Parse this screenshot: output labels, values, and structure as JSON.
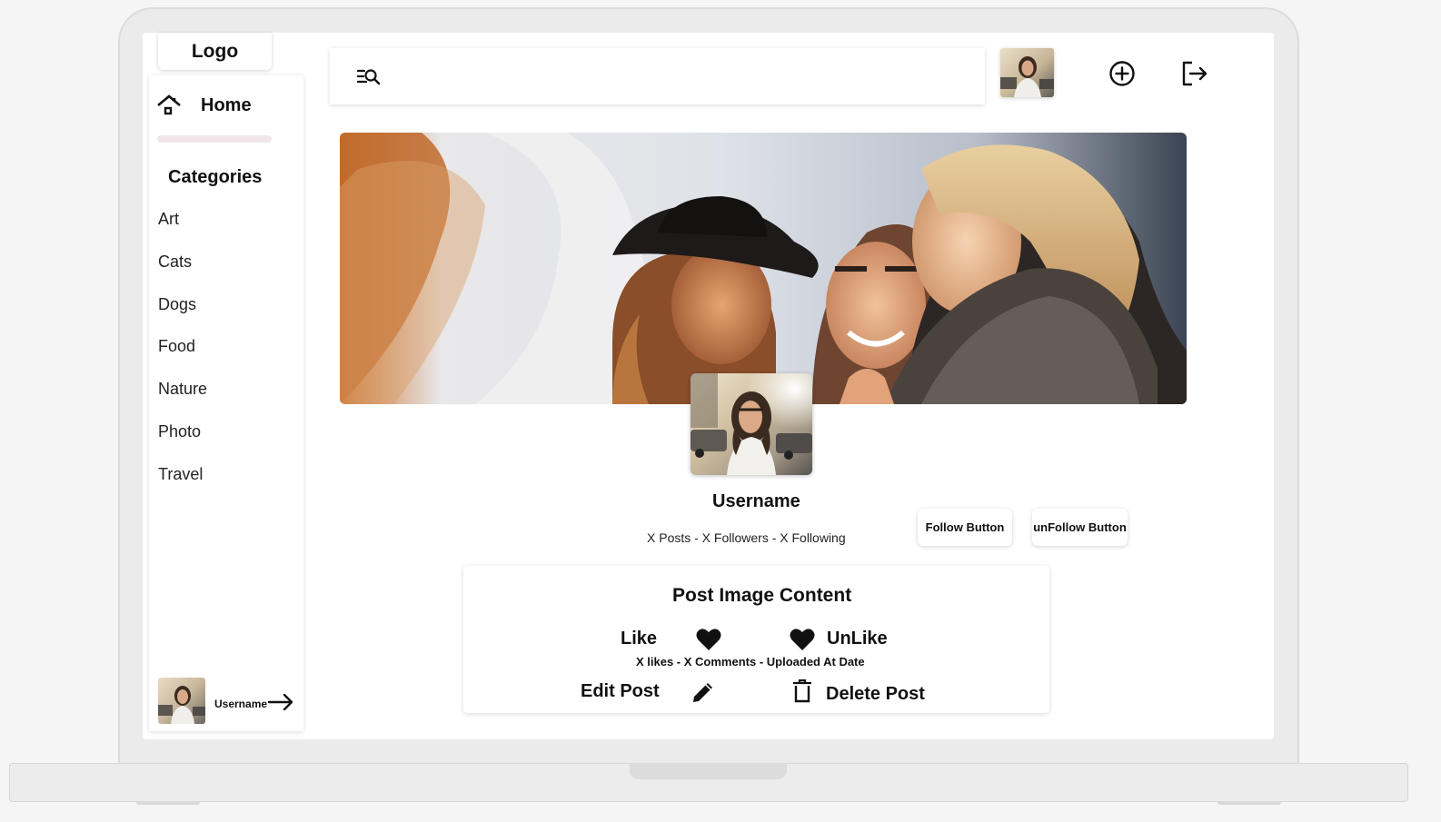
{
  "sidebar": {
    "logo": "Logo",
    "home_label": "Home",
    "categories_title": "Categories",
    "categories": [
      "Art",
      "Cats",
      "Dogs",
      "Food",
      "Nature",
      "Photo",
      "Travel"
    ],
    "user_name": "Username"
  },
  "search": {
    "placeholder": ""
  },
  "profile": {
    "username": "Username",
    "stats": "X Posts - X Followers - X Following",
    "follow_label": "Follow Button",
    "unfollow_label": "unFollow Button"
  },
  "post": {
    "title": "Post Image Content",
    "like_label": "Like",
    "unlike_label": "UnLike",
    "meta": "X likes - X Comments - Uploaded At Date",
    "edit_label": "Edit Post",
    "delete_label": "Delete Post"
  },
  "icons": {
    "home": "home-icon",
    "search": "search-icon",
    "add": "add-circle-icon",
    "logout": "logout-icon",
    "arrow": "arrow-right-icon",
    "heart": "heart-icon",
    "edit": "pencil-icon",
    "delete": "trash-icon"
  }
}
